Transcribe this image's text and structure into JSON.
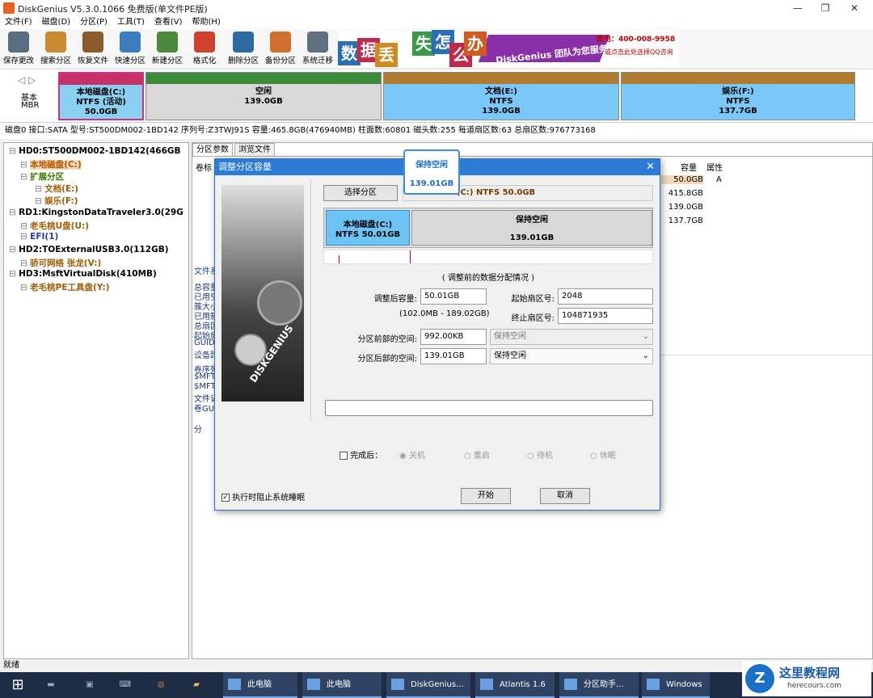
{
  "window": {
    "title": "DiskGenius V5.3.0.1066 免费版(单文件PE版)"
  },
  "menu": [
    "文件(F)",
    "磁盘(D)",
    "分区(P)",
    "工具(T)",
    "查看(V)",
    "帮助(H)"
  ],
  "toolbar": [
    {
      "label": "保存更改",
      "icon": "save-icon",
      "color": "#5a6c80"
    },
    {
      "label": "搜索分区",
      "icon": "search-icon",
      "color": "#c98a30"
    },
    {
      "label": "恢复文件",
      "icon": "recover-icon",
      "color": "#8a5a2a"
    },
    {
      "label": "快速分区",
      "icon": "quick-partition-icon",
      "color": "#3a7ec0"
    },
    {
      "label": "新建分区",
      "icon": "new-partition-icon",
      "color": "#4a8a3a"
    },
    {
      "label": "格式化",
      "icon": "format-icon",
      "color": "#d04030"
    },
    {
      "label": "删除分区",
      "icon": "delete-partition-icon",
      "color": "#2a6aa0"
    },
    {
      "label": "备份分区",
      "icon": "backup-icon",
      "color": "#d07030"
    },
    {
      "label": "系统迁移",
      "icon": "migrate-icon",
      "color": "#607080"
    }
  ],
  "banner": {
    "chars": [
      {
        "t": "数",
        "c": "#2a6fb5"
      },
      {
        "t": "据",
        "c": "#c02a4a"
      },
      {
        "t": "丢",
        "c": "#d08a20"
      },
      {
        "t": "失",
        "c": "#3a9a4a"
      },
      {
        "t": "怎",
        "c": "#2a6fb5"
      },
      {
        "t": "么",
        "c": "#c02a4a"
      },
      {
        "t": "办",
        "c": "#d05a20"
      }
    ],
    "slogan": "DiskGenius 团队为您服务",
    "phone": "致电：400-008-9958",
    "qq": "或点击此处选择QQ咨询"
  },
  "diskmap": {
    "basic": "基本",
    "mbr": "MBR",
    "partitions": [
      {
        "name": "本地磁盘(C:)",
        "fs": "NTFS (活动)",
        "size": "50.0GB",
        "bg": "#8ad0f0",
        "top": "#c8306a"
      },
      {
        "name": "空闲",
        "fs": "",
        "size": "139.0GB",
        "bg": "#d8d8d8",
        "top": "#3a8a3a"
      },
      {
        "name": "文档(E:)",
        "fs": "NTFS",
        "size": "139.0GB",
        "bg": "#7ac8f8",
        "top": "#b07a30"
      },
      {
        "name": "娱乐(F:)",
        "fs": "NTFS",
        "size": "137.7GB",
        "bg": "#7ac8f8",
        "top": "#b07a30"
      }
    ]
  },
  "diskinfo": "磁盘0 接口:SATA  型号:ST500DM002-1BD142  序列号:Z3TWJ91S  容量:465.8GB(476940MB)  柱面数:60801  磁头数:255  每道扇区数:63  总扇区数:976773168",
  "tree": [
    {
      "text": "HD0:ST500DM002-1BD142(466GB",
      "bold": true,
      "color": "#000"
    },
    {
      "text": "本地磁盘(C:)",
      "bold": true,
      "color": "#b05a00",
      "hl": true
    },
    {
      "text": "扩展分区",
      "bold": true,
      "color": "#3a7a00"
    },
    {
      "text": "文档(E:)",
      "bold": true,
      "color": "#a05a00"
    },
    {
      "text": "娱乐(F:)",
      "bold": true,
      "color": "#a05a00"
    },
    {
      "text": "RD1:KingstonDataTraveler3.0(29G",
      "bold": true,
      "color": "#000"
    },
    {
      "text": "老毛桃U盘(U:)",
      "bold": true,
      "color": "#a05a00"
    },
    {
      "text": "EFI(1)",
      "bold": true,
      "color": "#2a3a9a"
    },
    {
      "text": "HD2:TOExternalUSB3.0(112GB)",
      "bold": true,
      "color": "#000"
    },
    {
      "text": "骄可网络 张龙(V:)",
      "bold": true,
      "color": "#a05a00"
    },
    {
      "text": "HD3:MsftVirtualDisk(410MB)",
      "bold": true,
      "color": "#000"
    },
    {
      "text": "老毛桃PE工具盘(Y:)",
      "bold": true,
      "color": "#a05a00"
    }
  ],
  "right": {
    "tabs": [
      "分区参数",
      "浏览文件"
    ],
    "col_label": "卷标",
    "col_capacity": "容量",
    "col_attr": "属性",
    "rows": [
      {
        "cap": "50.0GB",
        "attr": "A"
      },
      {
        "cap": "415.8GB",
        "attr": ""
      },
      {
        "cap": "139.0GB",
        "attr": ""
      },
      {
        "cap": "137.7GB",
        "attr": ""
      }
    ],
    "left_labels": [
      "文件系",
      "总容量",
      "已用空",
      "簇大小",
      "已用簇",
      "总扇区",
      "起始扇",
      "GUID",
      "设备路",
      "卷序列",
      "$MFT",
      "$MFT",
      "文件记",
      "卷GUI",
      "分"
    ]
  },
  "dialog": {
    "title": "调整分区容量",
    "select_btn": "选择分区",
    "current": "(C:) NTFS 50.0GB",
    "bar_left_name": "本地磁盘(C:)",
    "bar_left_fs": "NTFS 50.01GB",
    "bar_right_name": "保持空闲",
    "bar_right_size": "139.01GB",
    "section": "( 调整前的数据分配情况 )",
    "size_after_label": "调整后容量:",
    "size_after": "50.01GB",
    "range": "(102.0MB - 189.02GB)",
    "start_label": "起始扇区号:",
    "start": "2048",
    "end_label": "终止扇区号:",
    "end": "104871935",
    "before_label": "分区前部的空间:",
    "before": "992.00KB",
    "before_sel": "保持空闲",
    "after_label": "分区后部的空间:",
    "after": "139.01GB",
    "after_sel": "保持空闲",
    "finish_label": "完成后：",
    "options": [
      "关机",
      "重启",
      "待机",
      "休眠"
    ],
    "prevent_sleep": "执行时阻止系统睡眠",
    "start_btn": "开始",
    "cancel_btn": "取消",
    "logo": "DISKGENIUS"
  },
  "callout": {
    "title": "保持空闲",
    "size": "139.01GB"
  },
  "status": "就绪",
  "taskbar": [
    {
      "label": "此电脑"
    },
    {
      "label": "此电脑"
    },
    {
      "label": "DiskGenius..."
    },
    {
      "label": "Atlantis 1.6"
    },
    {
      "label": "分区助手..."
    },
    {
      "label": "Windows"
    }
  ],
  "watermark": {
    "brand": "这里教程网",
    "site": "herecours.com"
  }
}
